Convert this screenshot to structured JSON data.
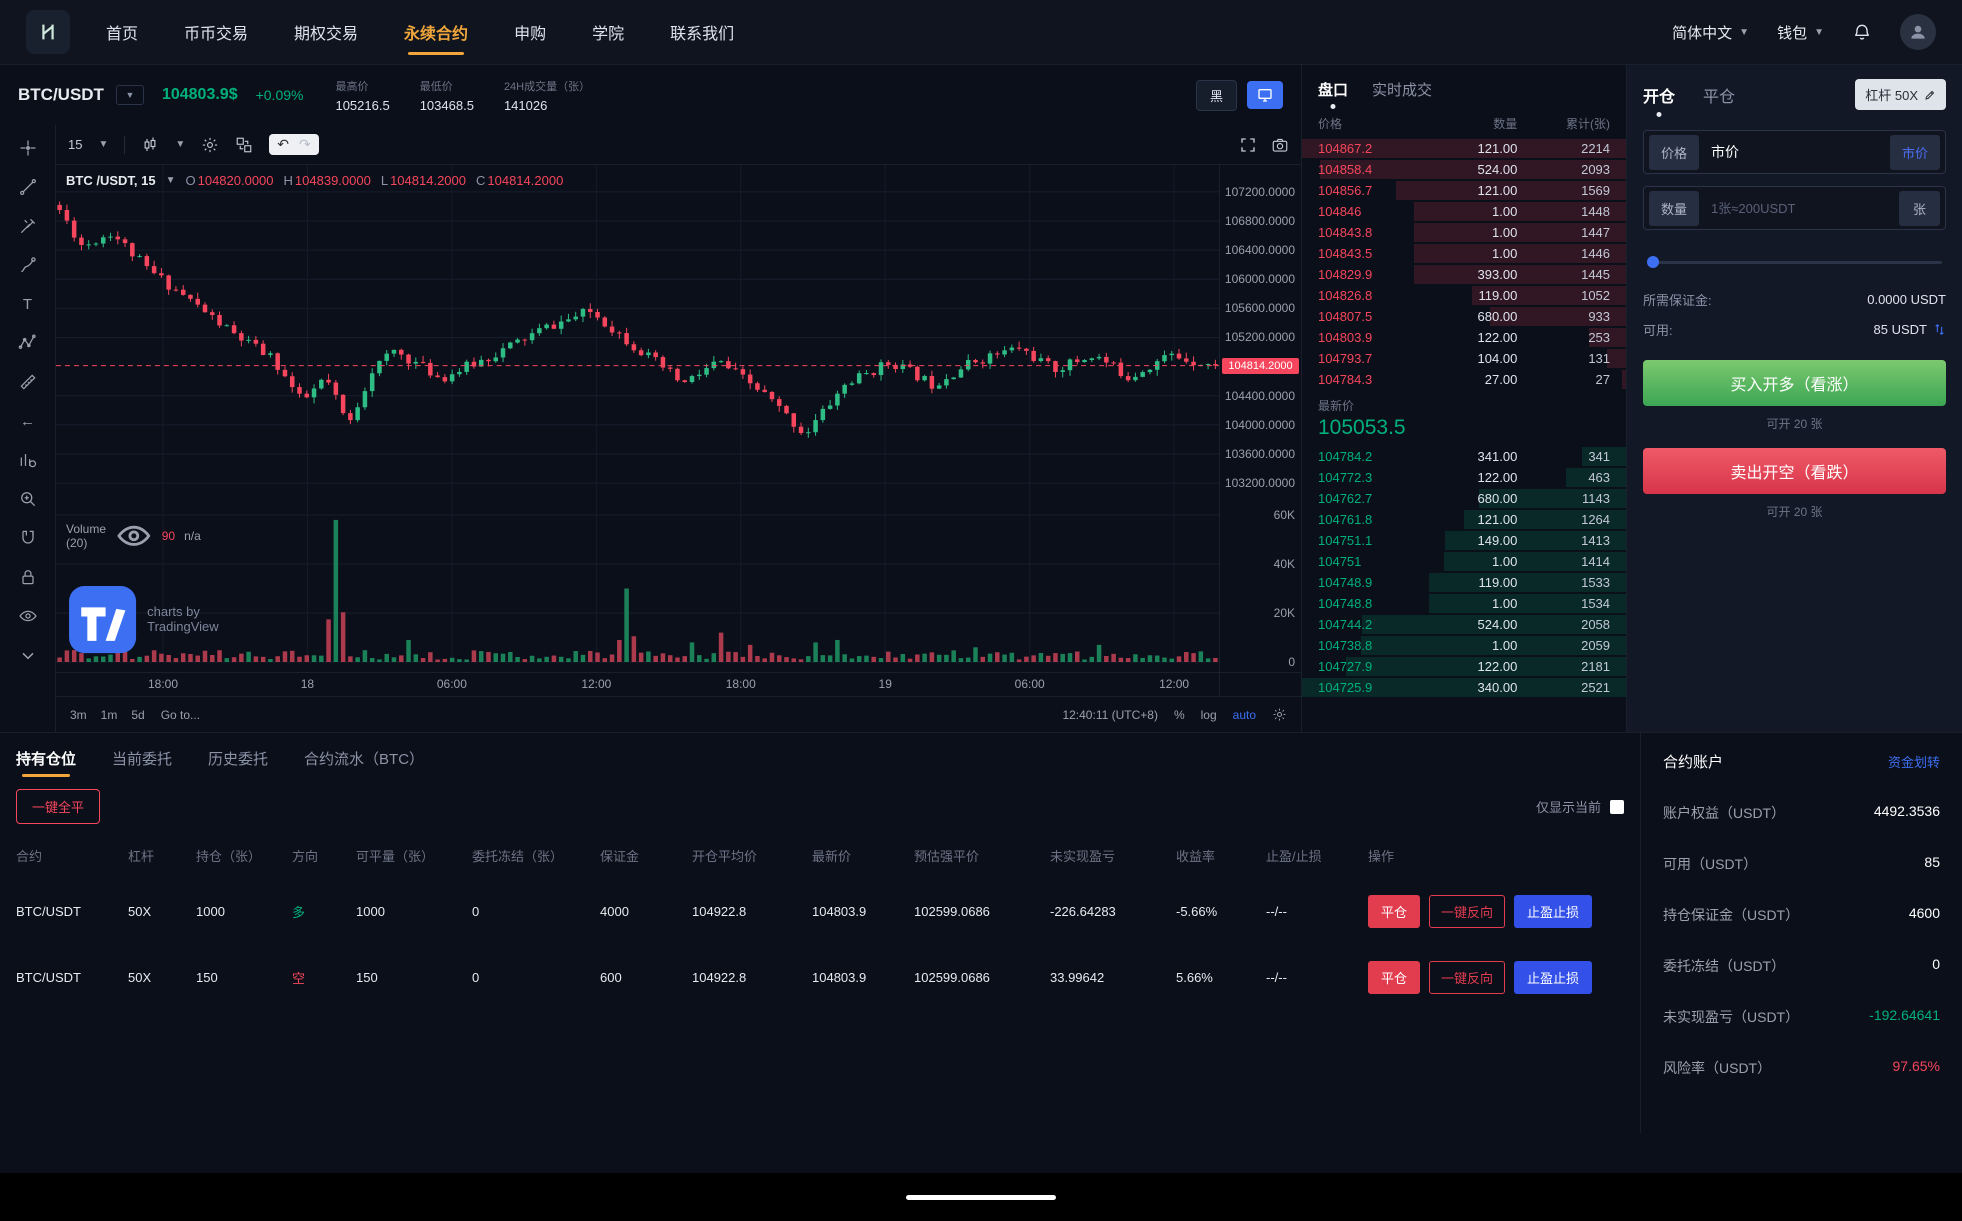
{
  "nav": {
    "items": [
      {
        "label": "首页",
        "active": false
      },
      {
        "label": "币币交易",
        "active": false
      },
      {
        "label": "期权交易",
        "active": false
      },
      {
        "label": "永续合约",
        "active": true
      },
      {
        "label": "申购",
        "active": false
      },
      {
        "label": "学院",
        "active": false
      },
      {
        "label": "联系我们",
        "active": false
      }
    ],
    "language": "简体中文",
    "wallet": "钱包"
  },
  "market_header": {
    "pair": "BTC/USDT",
    "price": "104803.9$",
    "change": "+0.09%",
    "stats": [
      {
        "label": "最高价",
        "value": "105216.5"
      },
      {
        "label": "最低价",
        "value": "103468.5"
      },
      {
        "label": "24H成交量（张）",
        "value": "141026"
      }
    ],
    "theme_button": "黑"
  },
  "chart": {
    "interval": "15",
    "legend": {
      "symbol_text": "BTC /USDT, 15",
      "o_label": "O",
      "o": "104820.0000",
      "h_label": "H",
      "h": "104839.0000",
      "l_label": "L",
      "l": "104814.2000",
      "c_label": "C",
      "c": "104814.2000"
    },
    "price_axis": [
      "107200.0000",
      "106800.0000",
      "106400.0000",
      "106000.0000",
      "105600.0000",
      "105200.0000",
      "104400.0000",
      "104000.0000",
      "103600.0000",
      "103200.0000"
    ],
    "last_price_tag": "104814.2000",
    "volume_legend": {
      "title": "Volume (20)",
      "ma": "90",
      "na": "n/a"
    },
    "volume_axis": [
      "60K",
      "40K",
      "20K",
      "0"
    ],
    "time_axis": [
      "18:00",
      "18",
      "06:00",
      "12:00",
      "18:00",
      "19",
      "06:00",
      "12:00"
    ],
    "watermark": "charts by TradingView",
    "footer": {
      "ranges": [
        {
          "label": "3m"
        },
        {
          "label": "1m"
        },
        {
          "label": "5d"
        }
      ],
      "goto": "Go to...",
      "clock": "12:40:11 (UTC+8)",
      "percent": "%",
      "log": "log",
      "auto": "auto"
    }
  },
  "orderbook": {
    "tabs": [
      {
        "label": "盘口",
        "active": true
      },
      {
        "label": "实时成交",
        "active": false
      }
    ],
    "columns": [
      "价格",
      "数量",
      "累计(张)"
    ],
    "asks": [
      {
        "price": "104867.2",
        "qty": "121.00",
        "total": "2214"
      },
      {
        "price": "104858.4",
        "qty": "524.00",
        "total": "2093"
      },
      {
        "price": "104856.7",
        "qty": "121.00",
        "total": "1569"
      },
      {
        "price": "104846",
        "qty": "1.00",
        "total": "1448"
      },
      {
        "price": "104843.8",
        "qty": "1.00",
        "total": "1447"
      },
      {
        "price": "104843.5",
        "qty": "1.00",
        "total": "1446"
      },
      {
        "price": "104829.9",
        "qty": "393.00",
        "total": "1445"
      },
      {
        "price": "104826.8",
        "qty": "119.00",
        "total": "1052"
      },
      {
        "price": "104807.5",
        "qty": "680.00",
        "total": "933"
      },
      {
        "price": "104803.9",
        "qty": "122.00",
        "total": "253"
      },
      {
        "price": "104793.7",
        "qty": "104.00",
        "total": "131"
      },
      {
        "price": "104784.3",
        "qty": "27.00",
        "total": "27"
      }
    ],
    "last_price_label": "最新价",
    "last_price": "105053.5",
    "bids": [
      {
        "price": "104784.2",
        "qty": "341.00",
        "total": "341"
      },
      {
        "price": "104772.3",
        "qty": "122.00",
        "total": "463"
      },
      {
        "price": "104762.7",
        "qty": "680.00",
        "total": "1143"
      },
      {
        "price": "104761.8",
        "qty": "121.00",
        "total": "1264"
      },
      {
        "price": "104751.1",
        "qty": "149.00",
        "total": "1413"
      },
      {
        "price": "104751",
        "qty": "1.00",
        "total": "1414"
      },
      {
        "price": "104748.9",
        "qty": "119.00",
        "total": "1533"
      },
      {
        "price": "104748.8",
        "qty": "1.00",
        "total": "1534"
      },
      {
        "price": "104744.2",
        "qty": "524.00",
        "total": "2058"
      },
      {
        "price": "104738.8",
        "qty": "1.00",
        "total": "2059"
      },
      {
        "price": "104727.9",
        "qty": "122.00",
        "total": "2181"
      },
      {
        "price": "104725.9",
        "qty": "340.00",
        "total": "2521"
      }
    ]
  },
  "trade_panel": {
    "tabs": [
      {
        "label": "开仓",
        "active": true
      },
      {
        "label": "平仓",
        "active": false
      }
    ],
    "leverage_button": "杠杆 50X",
    "price_label": "价格",
    "price_value": "市价",
    "market_button": "市价",
    "qty_label": "数量",
    "qty_placeholder": "1张≈200USDT",
    "unit": "张",
    "margin_label": "所需保证金:",
    "margin_value": "0.0000 USDT",
    "available_label": "可用:",
    "available_value": "85 USDT",
    "buy_button": "买入开多（看涨）",
    "buy_hint": "可开 20 张",
    "sell_button": "卖出开空（看跌）",
    "sell_hint": "可开 20 张"
  },
  "positions": {
    "tabs": [
      {
        "label": "持有仓位",
        "active": true
      },
      {
        "label": "当前委托",
        "active": false
      },
      {
        "label": "历史委托",
        "active": false
      },
      {
        "label": "合约流水（BTC）",
        "active": false
      }
    ],
    "close_all": "一键全平",
    "only_current": "仅显示当前",
    "columns": [
      "合约",
      "杠杆",
      "持仓（张）",
      "方向",
      "可平量（张）",
      "委托冻结（张）",
      "保证金",
      "开仓平均价",
      "最新价",
      "预估强平价",
      "未实现盈亏",
      "收益率",
      "止盈/止损",
      "操作"
    ],
    "actions": {
      "close": "平仓",
      "reverse": "一键反向",
      "tpsl": "止盈止损"
    },
    "rows": [
      {
        "contract": "BTC/USDT",
        "leverage": "50X",
        "qty": "1000",
        "direction": "多",
        "dir_class": "long",
        "closable": "1000",
        "frozen": "0",
        "margin": "4000",
        "avg_price": "104922.8",
        "last_price": "104803.9",
        "liq_price": "102599.0686",
        "pnl": "-226.64283",
        "roe": "-5.66%",
        "tpsl": "--/--"
      },
      {
        "contract": "BTC/USDT",
        "leverage": "50X",
        "qty": "150",
        "direction": "空",
        "dir_class": "short",
        "closable": "150",
        "frozen": "0",
        "margin": "600",
        "avg_price": "104922.8",
        "last_price": "104803.9",
        "liq_price": "102599.0686",
        "pnl": "33.99642",
        "roe": "5.66%",
        "tpsl": "--/--"
      }
    ]
  },
  "account": {
    "title": "合约账户",
    "transfer_link": "资金划转",
    "rows": [
      {
        "label": "账户权益（USDT）",
        "value": "4492.3536",
        "class": ""
      },
      {
        "label": "可用（USDT）",
        "value": "85",
        "class": ""
      },
      {
        "label": "持仓保证金（USDT）",
        "value": "4600",
        "class": ""
      },
      {
        "label": "委托冻结（USDT）",
        "value": "0",
        "class": ""
      },
      {
        "label": "未实现盈亏（USDT）",
        "value": "-192.64641",
        "class": "green"
      },
      {
        "label": "风险率（USDT）",
        "value": "97.65%",
        "class": "red"
      }
    ]
  },
  "colors": {
    "green": "#00b07c",
    "red": "#f6465d",
    "blue": "#3d6ff2",
    "accent": "#f0a63a"
  }
}
